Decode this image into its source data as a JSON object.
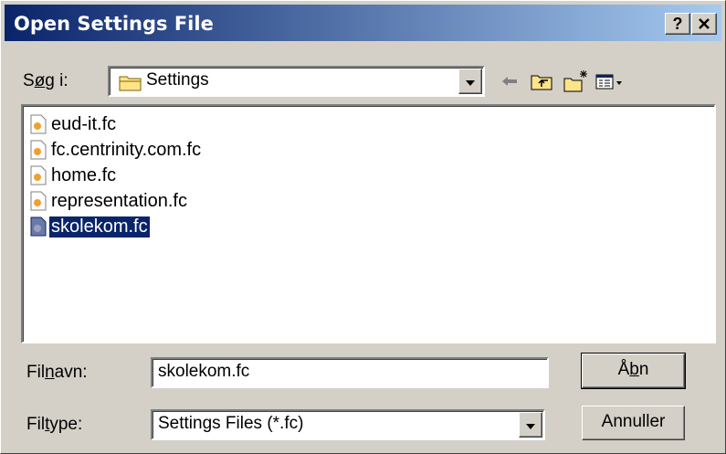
{
  "title": "Open Settings File",
  "title_buttons": {
    "help": "?",
    "close": "×"
  },
  "lookin": {
    "label_prefix": "S",
    "label_underline": "ø",
    "label_suffix": "g i:",
    "value": "Settings"
  },
  "toolbar_icons": [
    "back-arrow-icon",
    "up-folder-icon",
    "new-folder-icon",
    "view-menu-icon"
  ],
  "files": [
    {
      "name": "eud-it.fc",
      "selected": false
    },
    {
      "name": "fc.centrinity.com.fc",
      "selected": false
    },
    {
      "name": "home.fc",
      "selected": false
    },
    {
      "name": "representation.fc",
      "selected": false
    },
    {
      "name": "skolekom.fc",
      "selected": true
    }
  ],
  "filename": {
    "label_prefix": "Fil",
    "label_underline": "n",
    "label_suffix": "avn:",
    "value": "skolekom.fc"
  },
  "filetype": {
    "label_prefix": "Fil",
    "label_underline": "t",
    "label_suffix": "ype:",
    "value": "Settings Files (*.fc)"
  },
  "buttons": {
    "open_prefix": "Å",
    "open_underline": "b",
    "open_suffix": "n",
    "cancel": "Annuller"
  },
  "colors": {
    "titlebar_start": "#0a246a",
    "titlebar_end": "#a6caf0",
    "selection": "#0a246a",
    "face": "#d4d0c8"
  }
}
